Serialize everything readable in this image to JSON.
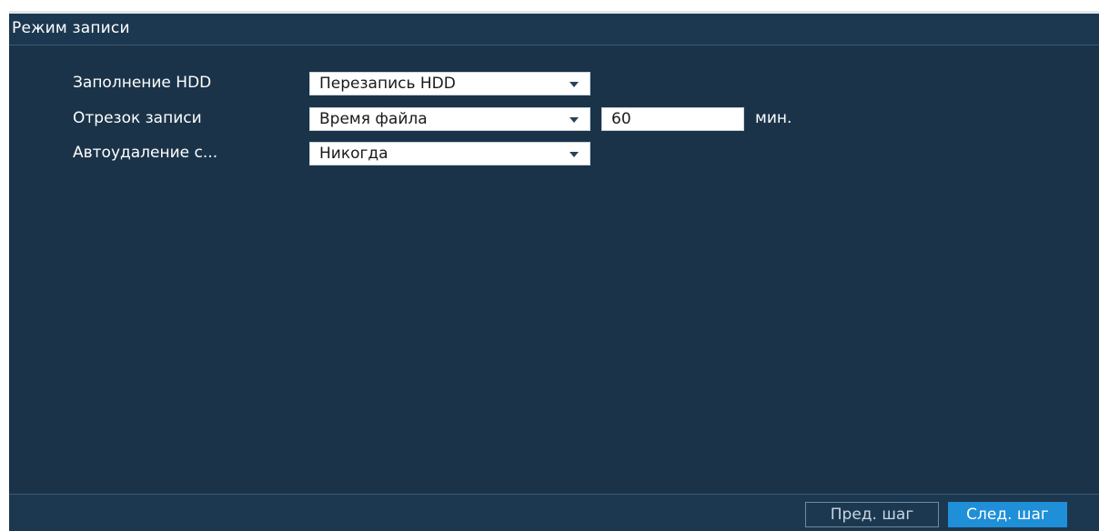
{
  "window": {
    "title": "Режим записи"
  },
  "form": {
    "hdd_full": {
      "label": "Заполнение HDD",
      "value": "Перезапись HDD"
    },
    "record_segment": {
      "label": "Отрезок записи",
      "value": "Время файла",
      "length_value": "60",
      "unit": "мин."
    },
    "auto_delete": {
      "label": "Автоудаление с...",
      "value": "Никогда"
    }
  },
  "footer": {
    "prev_label": "Пред. шаг",
    "next_label": "След. шаг"
  },
  "colors": {
    "background": "#1a3349",
    "accent": "#1f8fd8",
    "text": "#ffffff"
  },
  "icons": {
    "dropdown": "chevron-down-icon"
  }
}
